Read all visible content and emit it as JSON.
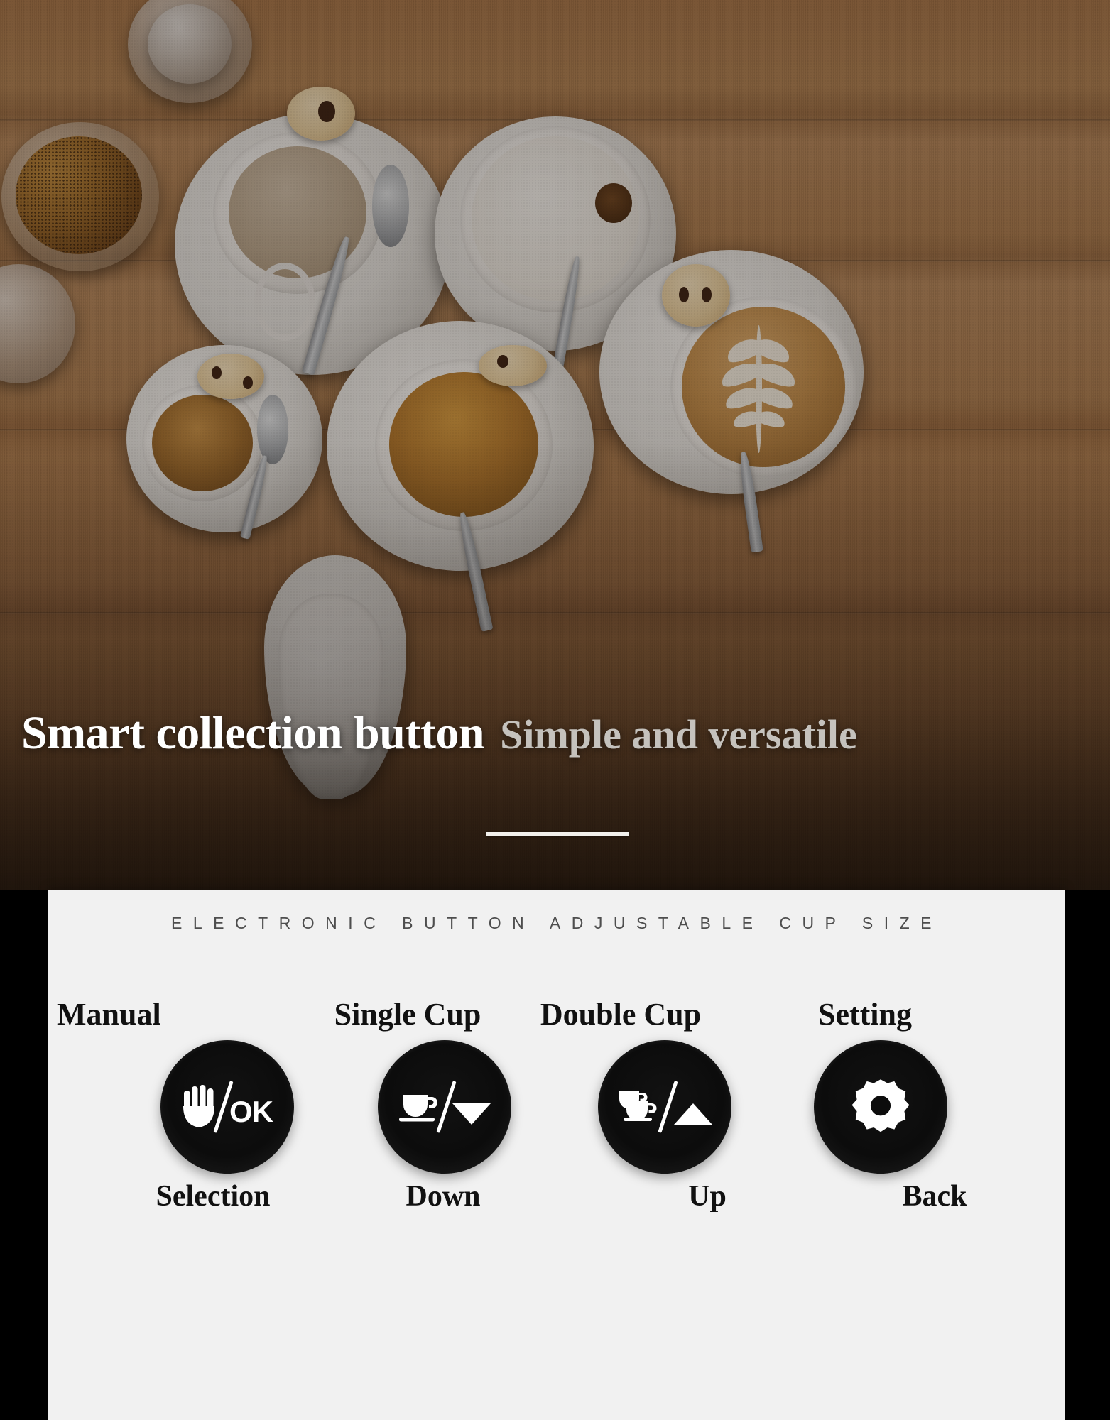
{
  "hero": {
    "alt": "overhead photo of coffee cups on a wooden table",
    "scene_items": [
      "cappuccino-cup",
      "milk-coffee-cup",
      "foam-cup",
      "latte-art-cup",
      "espresso-cup",
      "sugar-jar",
      "glass-jar",
      "spoons",
      "cookies"
    ]
  },
  "title": {
    "main": "Smart collection button",
    "sub": "Simple and versatile"
  },
  "panel": {
    "kicker": "ELECTRONIC BUTTON ADJUSTABLE CUP SIZE"
  },
  "buttons": [
    {
      "top_label": "Manual",
      "bottom_label": "Selection",
      "icon": "hand-ok-icon",
      "glyph_parts": [
        "hand",
        "slash",
        "OK"
      ],
      "ok_text": "OK"
    },
    {
      "top_label": "Single Cup",
      "bottom_label": "Down",
      "icon": "cup-down-icon",
      "glyph_parts": [
        "single-cup",
        "slash",
        "triangle-down"
      ]
    },
    {
      "top_label": "Double Cup",
      "bottom_label": "Up",
      "icon": "double-cup-up-icon",
      "glyph_parts": [
        "double-cup",
        "slash",
        "triangle-up"
      ]
    },
    {
      "top_label": "Setting",
      "bottom_label": "Back",
      "icon": "gear-icon",
      "glyph_parts": [
        "gear"
      ]
    }
  ],
  "colors": {
    "panel_bg": "#f1f1f1",
    "button_bg": "#0c0c0c",
    "button_rim": "#6e6e6e",
    "title_main": "#ffffff",
    "title_sub": "#c5c2bd",
    "kicker": "#4e4e4e",
    "label": "#111111",
    "page_bg": "#000000"
  }
}
